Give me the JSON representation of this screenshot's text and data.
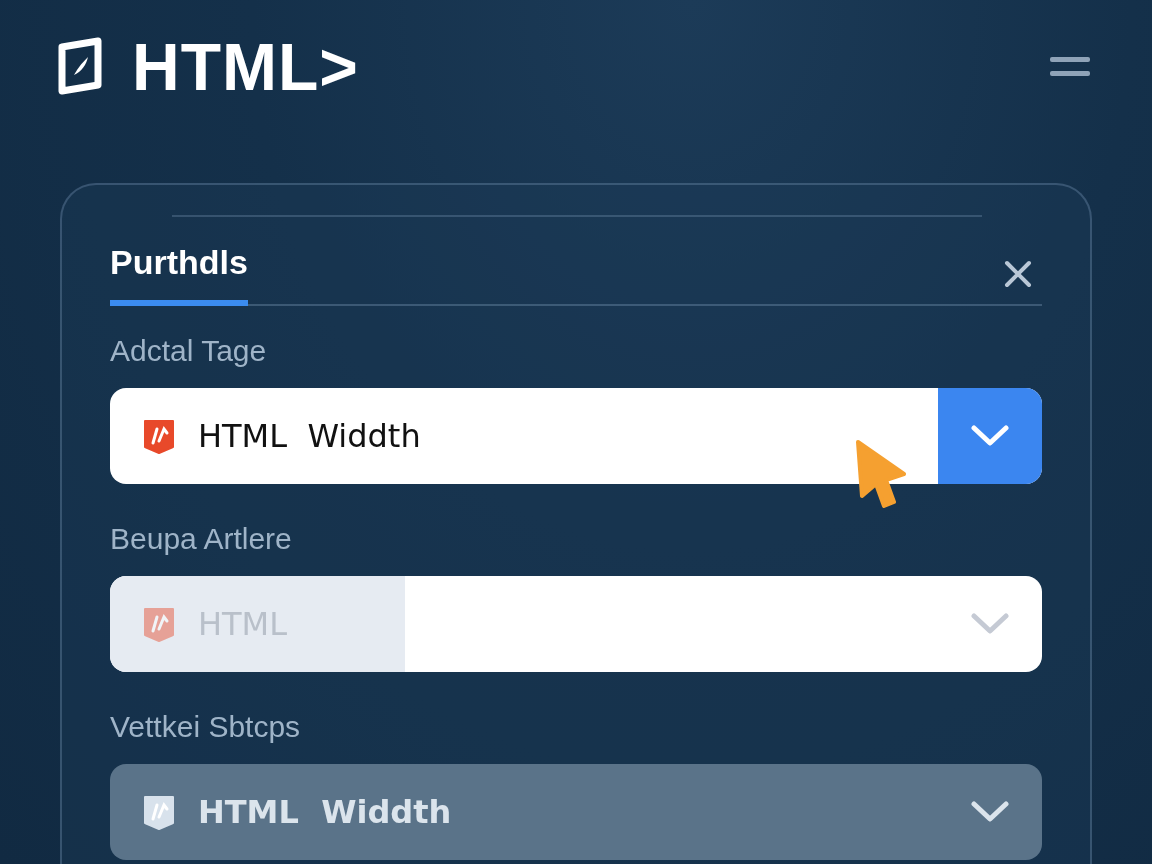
{
  "logo": {
    "text": "HTML>"
  },
  "tab": {
    "label": "Purthdls",
    "selected": true
  },
  "fields": [
    {
      "label": "Adctal Tage",
      "kind": "active",
      "value": "HTML  Widdth"
    },
    {
      "label": "Beupa Artlere",
      "kind": "faded",
      "value": "HTML"
    },
    {
      "label": "Vettkei Sbtcps",
      "kind": "muted",
      "value": "HTML  Widdth"
    }
  ]
}
